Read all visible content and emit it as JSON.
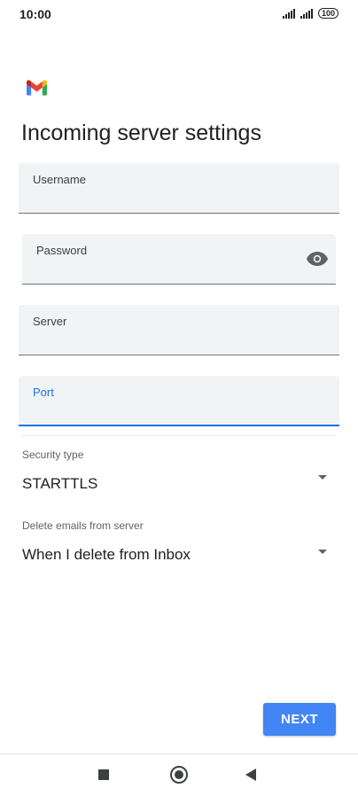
{
  "status_bar": {
    "time": "10:00",
    "battery": "100",
    "icons": [
      "signal-icon",
      "signal-icon",
      "battery-icon"
    ]
  },
  "app": {
    "logo": "gmail-logo",
    "title": "Incoming server settings"
  },
  "form": {
    "username": {
      "label": "Username",
      "value": ""
    },
    "password": {
      "label": "Password",
      "value": ""
    },
    "server": {
      "label": "Server",
      "value": ""
    },
    "port": {
      "label": "Port",
      "value": ""
    },
    "security_type": {
      "label": "Security type",
      "value": "STARTTLS"
    },
    "delete_emails": {
      "label": "Delete emails from server",
      "value": "When I delete from Inbox"
    }
  },
  "actions": {
    "next_label": "NEXT"
  },
  "colors": {
    "accent": "#1a73e8",
    "button": "#4285f4",
    "field_bg": "#f1f3f4"
  }
}
